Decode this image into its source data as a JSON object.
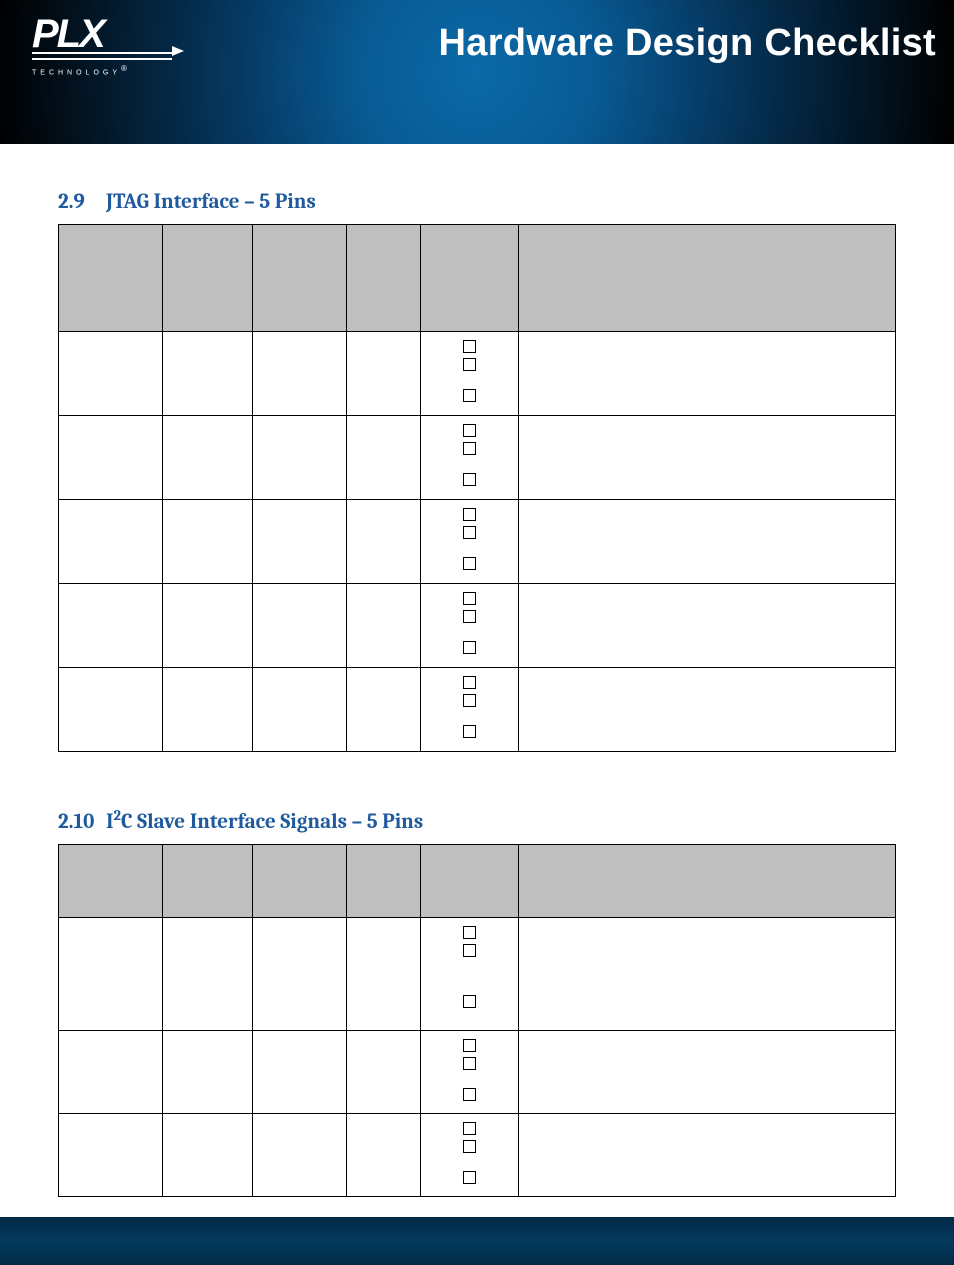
{
  "header": {
    "doc_title": "Hardware Design Checklist",
    "logo_text": "PLX",
    "logo_subtext": "TECHNOLOGY",
    "logo_reg": "®"
  },
  "sections": [
    {
      "number": "2.9",
      "title": "JTAG Interface – 5 Pins",
      "table": {
        "headers": [
          "",
          "",
          "",
          "",
          "",
          ""
        ],
        "rows": [
          {
            "c1": "",
            "c2": "",
            "c3": "",
            "c4": "",
            "c5_checkboxes": 3,
            "c6": ""
          },
          {
            "c1": "",
            "c2": "",
            "c3": "",
            "c4": "",
            "c5_checkboxes": 3,
            "c6": ""
          },
          {
            "c1": "",
            "c2": "",
            "c3": "",
            "c4": "",
            "c5_checkboxes": 3,
            "c6": ""
          },
          {
            "c1": "",
            "c2": "",
            "c3": "",
            "c4": "",
            "c5_checkboxes": 3,
            "c6": ""
          },
          {
            "c1": "",
            "c2": "",
            "c3": "",
            "c4": "",
            "c5_checkboxes": 3,
            "c6": ""
          }
        ]
      }
    },
    {
      "number": "2.10",
      "title_prefix": "I",
      "title_sup": "2",
      "title_suffix": "C Slave Interface Signals – 5 Pins",
      "table": {
        "headers": [
          "",
          "",
          "",
          "",
          "",
          ""
        ],
        "rows": [
          {
            "c1": "",
            "c2": "",
            "c3": "",
            "c4": "",
            "c5_checkboxes": 3,
            "c6": ""
          },
          {
            "c1": "",
            "c2": "",
            "c3": "",
            "c4": "",
            "c5_checkboxes": 3,
            "c6": ""
          },
          {
            "c1": "",
            "c2": "",
            "c3": "",
            "c4": "",
            "c5_checkboxes": 3,
            "c6": ""
          }
        ]
      }
    }
  ]
}
